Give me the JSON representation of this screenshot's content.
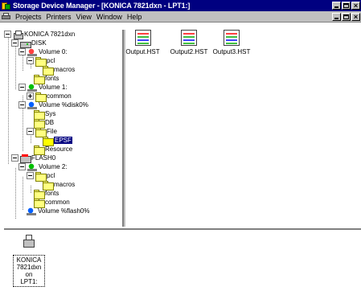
{
  "window": {
    "title": "Storage Device Manager - [KONICA 7821dxn - LPT1:]",
    "controls": {
      "minimize": "minimize",
      "maximize": "maximize",
      "close": "x"
    }
  },
  "menubar": {
    "items": [
      "Projects",
      "Printers",
      "View",
      "Window",
      "Help"
    ]
  },
  "tree": {
    "nodes": [
      {
        "label": "KONICA 7821dxn",
        "icon": "printer-icon",
        "expanded": true
      },
      {
        "label": "DISK",
        "icon": "disk-icon",
        "expanded": true
      },
      {
        "label": "Volume 0:",
        "icon": "volume-icon-red",
        "expanded": true
      },
      {
        "label": "pcl",
        "icon": "folder-icon",
        "expanded": true
      },
      {
        "label": "macros",
        "icon": "folder-icon"
      },
      {
        "label": "fonts",
        "icon": "folder-icon"
      },
      {
        "label": "Volume 1:",
        "icon": "volume-icon-green",
        "expanded": true
      },
      {
        "label": "common",
        "icon": "folder-icon",
        "expanded": false
      },
      {
        "label": "Volume %disk0%",
        "icon": "volume-icon-blue",
        "expanded": true
      },
      {
        "label": "Sys",
        "icon": "folder-icon"
      },
      {
        "label": "DB",
        "icon": "folder-icon"
      },
      {
        "label": "File",
        "icon": "folder-icon",
        "expanded": true
      },
      {
        "label": "EPSF",
        "icon": "folder-icon",
        "selected": true
      },
      {
        "label": "Resource",
        "icon": "folder-icon"
      },
      {
        "label": "FLASH0",
        "icon": "flash-icon",
        "expanded": true
      },
      {
        "label": "Volume 2:",
        "icon": "volume-icon-green",
        "expanded": true
      },
      {
        "label": "pcl",
        "icon": "folder-icon",
        "expanded": true
      },
      {
        "label": "macros",
        "icon": "folder-icon"
      },
      {
        "label": "fonts",
        "icon": "folder-icon"
      },
      {
        "label": "common",
        "icon": "folder-icon"
      },
      {
        "label": "Volume %flash0%",
        "icon": "volume-icon-blue"
      }
    ]
  },
  "files": {
    "items": [
      {
        "label": "Output.HST"
      },
      {
        "label": "Output2.HST"
      },
      {
        "label": "Output3.HST"
      }
    ]
  },
  "printers_panel": {
    "printer_label_line1": "KONICA",
    "printer_label_line2": "7821dxn on",
    "printer_label_line3": "LPT1:"
  },
  "colors": {
    "titlebar": "#000080",
    "selection": "#000080",
    "chrome": "#c0c0c0"
  }
}
